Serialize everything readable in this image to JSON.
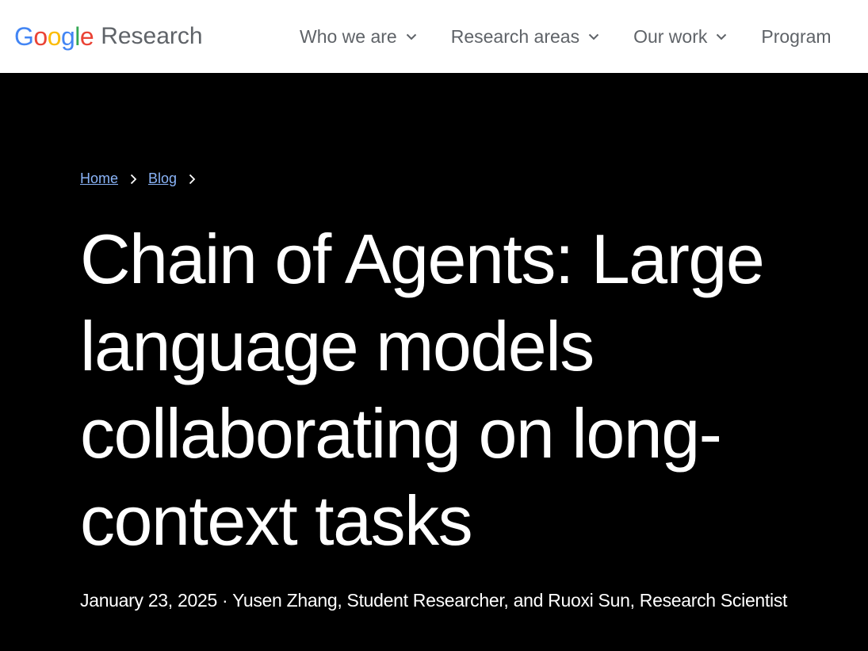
{
  "header": {
    "logo": {
      "google_letters": [
        {
          "char": "G",
          "color": "#4285F4"
        },
        {
          "char": "o",
          "color": "#EA4335"
        },
        {
          "char": "o",
          "color": "#FBBC05"
        },
        {
          "char": "g",
          "color": "#4285F4"
        },
        {
          "char": "l",
          "color": "#34A853"
        },
        {
          "char": "e",
          "color": "#EA4335"
        }
      ],
      "suffix": "Research"
    },
    "nav": [
      {
        "label": "Who we are",
        "icon": "chevron-down-icon"
      },
      {
        "label": "Research areas",
        "icon": "chevron-down-icon"
      },
      {
        "label": "Our work",
        "icon": "chevron-down-icon"
      },
      {
        "label": "Program",
        "icon": "chevron-down-icon"
      }
    ]
  },
  "breadcrumb": {
    "items": [
      {
        "label": "Home"
      },
      {
        "label": "Blog"
      }
    ],
    "separator_icon": "chevron-right-icon"
  },
  "article": {
    "title": "Chain of Agents: Large language models collaborating on long-context tasks",
    "date": "January 23, 2025",
    "separator": "·",
    "authors": "Yusen Zhang, Student Researcher, and Ruoxi Sun, Research Scientist"
  },
  "colors": {
    "hero_background": "#000000",
    "header_background": "#ffffff",
    "link": "#8ab4f8",
    "nav_text": "#5f6368"
  }
}
